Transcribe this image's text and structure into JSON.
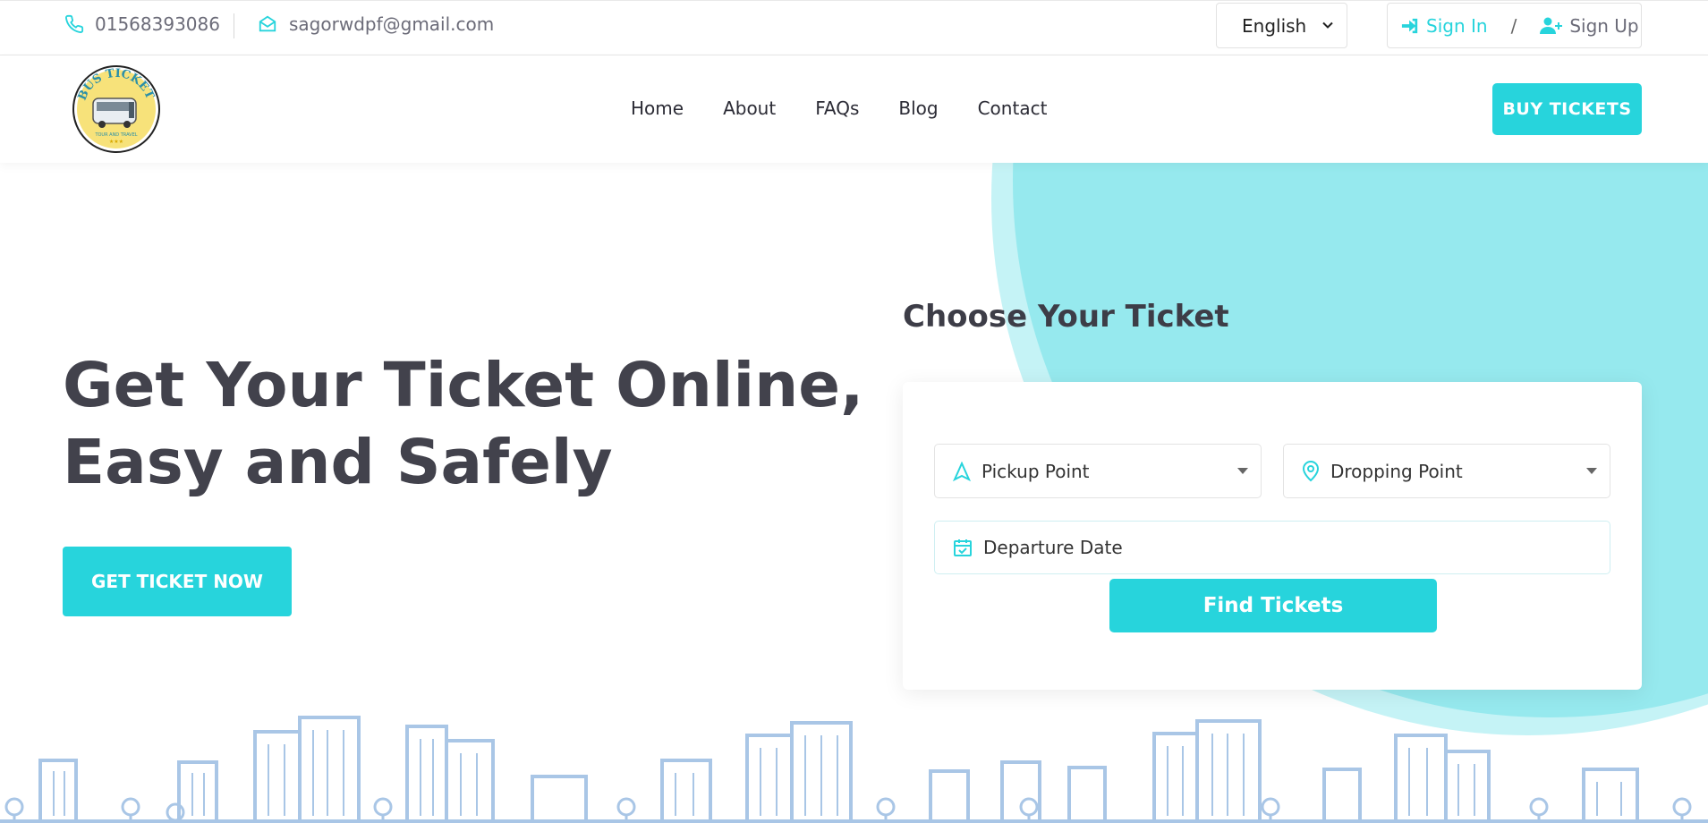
{
  "topbar": {
    "phone": "01568393086",
    "email": "sagorwdpf@gmail.com",
    "language": "English",
    "sign_in": "Sign In",
    "separator": "/",
    "sign_up": "Sign Up"
  },
  "nav": {
    "logo_text": "BUS TICKET",
    "logo_subtext": "TOUR AND TRAVEL",
    "items": [
      "Home",
      "About",
      "FAQs",
      "Blog",
      "Contact"
    ],
    "buy_button": "BUY  TICKETS"
  },
  "hero": {
    "headline_line1": "Get Your Ticket Online,",
    "headline_line2": "Easy and Safely",
    "cta": "GET TICKET NOW"
  },
  "search": {
    "title": "Choose Your Ticket",
    "pickup_placeholder": "Pickup Point",
    "dropping_placeholder": "Dropping Point",
    "date_placeholder": "Departure Date",
    "submit": "Find Tickets"
  },
  "colors": {
    "accent": "#27d4dc",
    "blob": "#96e9ee",
    "text": "#42424c",
    "skyline": "#a9c6e6"
  },
  "icons": {
    "phone": "phone-icon",
    "email": "envelope-icon",
    "sign_in": "sign-in-icon",
    "sign_up": "user-plus-icon",
    "pickup": "navigation-arrow-icon",
    "dropping": "map-pin-icon",
    "date": "calendar-check-icon"
  }
}
